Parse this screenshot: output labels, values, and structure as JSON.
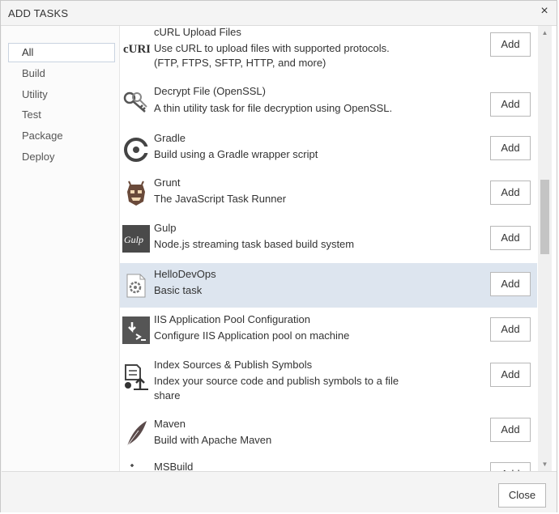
{
  "dialog": {
    "title": "ADD TASKS",
    "close_glyph": "×"
  },
  "sidebar": {
    "items": [
      {
        "label": "All",
        "selected": true
      },
      {
        "label": "Build"
      },
      {
        "label": "Utility"
      },
      {
        "label": "Test"
      },
      {
        "label": "Package"
      },
      {
        "label": "Deploy"
      }
    ]
  },
  "tasks": [
    {
      "name": "cURL Upload Files",
      "desc_lines": [
        "Use cURL to upload files with supported protocols.",
        "(FTP, FTPS, SFTP, HTTP, and more)"
      ],
      "icon": "curl-icon",
      "icon_text": "cURL",
      "add": "Add"
    },
    {
      "name": "Decrypt File (OpenSSL)",
      "desc_lines": [
        "A thin utility task for file decryption using OpenSSL."
      ],
      "icon": "key-icon",
      "add": "Add"
    },
    {
      "name": "Gradle",
      "desc_lines": [
        "Build using a Gradle wrapper script"
      ],
      "icon": "gradle-icon",
      "add": "Add"
    },
    {
      "name": "Grunt",
      "desc_lines": [
        "The JavaScript Task Runner"
      ],
      "icon": "grunt-icon",
      "add": "Add"
    },
    {
      "name": "Gulp",
      "desc_lines": [
        "Node.js streaming task based build system"
      ],
      "icon": "gulp-icon",
      "icon_text": "Gulp",
      "add": "Add"
    },
    {
      "name": "HelloDevOps",
      "desc_lines": [
        "Basic task"
      ],
      "icon": "gear-document-icon",
      "add": "Add",
      "selected": true
    },
    {
      "name": "IIS Application Pool Configuration",
      "desc_lines": [
        "Configure IIS Application pool on machine"
      ],
      "icon": "iis-download-icon",
      "add": "Add"
    },
    {
      "name": "Index Sources & Publish Symbols",
      "desc_lines": [
        "Index your source code and publish symbols to a file",
        "share"
      ],
      "icon": "index-publish-icon",
      "add": "Add"
    },
    {
      "name": "Maven",
      "desc_lines": [
        "Build with Apache Maven"
      ],
      "icon": "maven-feather-icon",
      "add": "Add"
    },
    {
      "name": "MSBuild",
      "desc_lines": [],
      "icon": "msbuild-icon",
      "add": "Add"
    }
  ],
  "footer": {
    "close_label": "Close"
  }
}
